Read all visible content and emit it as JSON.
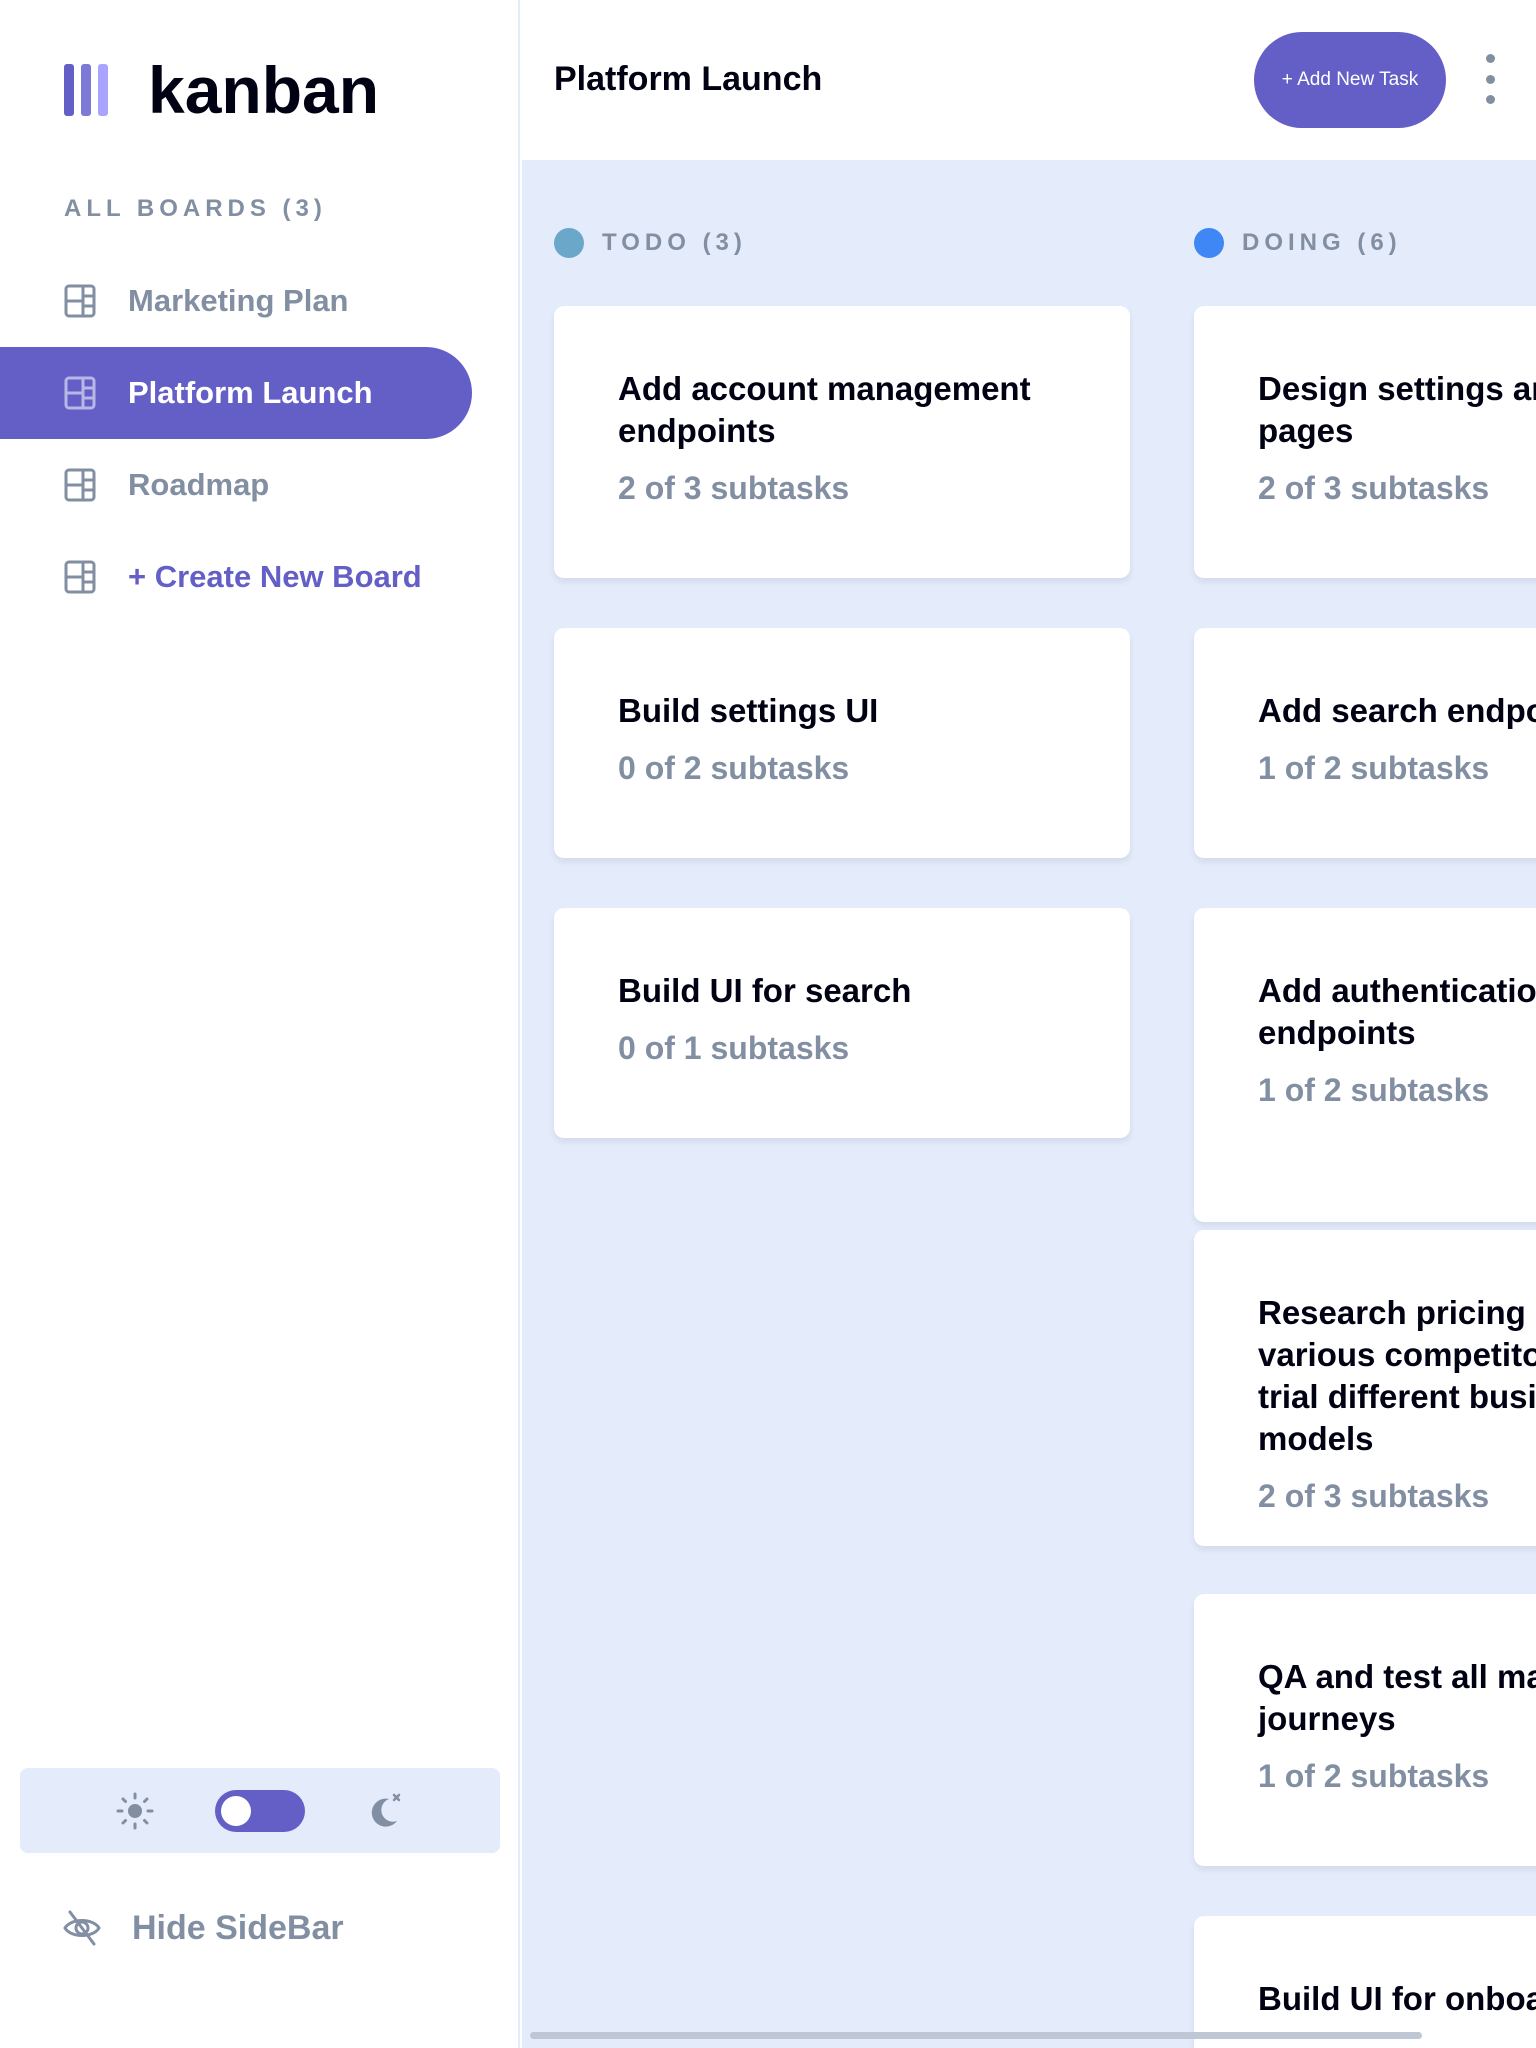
{
  "logo": {
    "text": "kanban"
  },
  "sidebar": {
    "heading": "ALL BOARDS (3)",
    "boards": [
      {
        "label": "Marketing Plan",
        "active": false
      },
      {
        "label": "Platform Launch",
        "active": true
      },
      {
        "label": "Roadmap",
        "active": false
      }
    ],
    "create_label": "+ Create New Board",
    "hide_label": "Hide SideBar"
  },
  "header": {
    "title": "Platform Launch",
    "add_task_label": "+ Add New Task"
  },
  "columns": [
    {
      "title": "TODO (3)",
      "dot_color": "#6aa7c9",
      "cards": [
        {
          "title": "Add account management endpoints",
          "subtasks": "2 of 3 subtasks"
        },
        {
          "title": "Build settings UI",
          "subtasks": "0 of 2 subtasks"
        },
        {
          "title": "Build UI for search",
          "subtasks": "0 of 1 subtasks"
        }
      ]
    },
    {
      "title": "DOING (6)",
      "dot_color": "#3f87f5",
      "cards": [
        {
          "title": "Design settings and search pages",
          "subtasks": "2 of 3 subtasks"
        },
        {
          "title": "Add search endpoints",
          "subtasks": "1 of 2 subtasks"
        },
        {
          "title": "Add authentication endpoints",
          "subtasks": "1 of 2 subtasks"
        },
        {
          "title": "Research pricing points of various competitors and trial different business models",
          "subtasks": "2 of 3 subtasks"
        },
        {
          "title": "QA and test all major user journeys",
          "subtasks": "1 of 2 subtasks"
        },
        {
          "title": "Build UI for onboarding flow",
          "subtasks": ""
        }
      ]
    }
  ],
  "colors": {
    "accent": "#635fc7",
    "board_bg": "#e4ebfa",
    "muted_text": "#828fa3",
    "dark_text": "#000112"
  }
}
